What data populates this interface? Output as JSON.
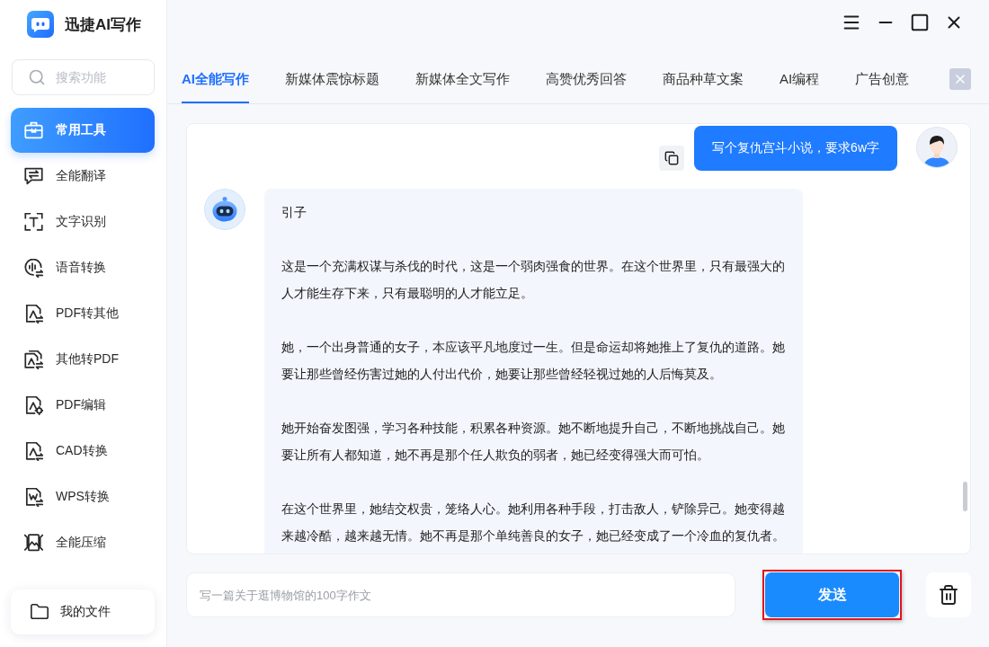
{
  "app": {
    "title": "迅捷AI写作"
  },
  "sidebar": {
    "search": {
      "placeholder": "搜索功能"
    },
    "items": [
      {
        "label": "常用工具",
        "selected": true
      },
      {
        "label": "全能翻译",
        "selected": false
      },
      {
        "label": "文字识别",
        "selected": false
      },
      {
        "label": "语音转换",
        "selected": false
      },
      {
        "label": "PDF转其他",
        "selected": false
      },
      {
        "label": "其他转PDF",
        "selected": false
      },
      {
        "label": "PDF编辑",
        "selected": false
      },
      {
        "label": "CAD转换",
        "selected": false
      },
      {
        "label": "WPS转换",
        "selected": false
      },
      {
        "label": "全能压缩",
        "selected": false
      }
    ],
    "my_files": {
      "label": "我的文件"
    }
  },
  "tabs": [
    {
      "label": "AI全能写作",
      "selected": true
    },
    {
      "label": "新媒体震惊标题",
      "selected": false
    },
    {
      "label": "新媒体全文写作",
      "selected": false
    },
    {
      "label": "高赞优秀回答",
      "selected": false
    },
    {
      "label": "商品种草文案",
      "selected": false
    },
    {
      "label": "AI编程",
      "selected": false
    },
    {
      "label": "广告创意",
      "selected": false
    }
  ],
  "chat": {
    "messages": [
      {
        "kind": "user",
        "text": "写个复仇宫斗小说，要求6w字"
      },
      {
        "kind": "assistant",
        "paragraphs": [
          "引子",
          "这是一个充满权谋与杀伐的时代，这是一个弱肉强食的世界。在这个世界里，只有最强大的人才能生存下来，只有最聪明的人才能立足。",
          "她，一个出身普通的女子，本应该平凡地度过一生。但是命运却将她推上了复仇的道路。她要让那些曾经伤害过她的人付出代价，她要让那些曾经轻视过她的人后悔莫及。",
          "她开始奋发图强，学习各种技能，积累各种资源。她不断地提升自己，不断地挑战自己。她要让所有人都知道，她不再是那个任人欺负的弱者，她已经变得强大而可怕。",
          "在这个世界里，她结交权贵，笼络人心。她利用各种手段，打击敌人，铲除异己。她变得越来越冷酷，越来越无情。她不再是那个单纯善良的女子，她已经变成了一个冷血的复仇者。"
        ]
      }
    ]
  },
  "composer": {
    "placeholder": "写一篇关于逛博物馆的100字作文",
    "send_label": "发送",
    "send_highlighted": true
  }
}
